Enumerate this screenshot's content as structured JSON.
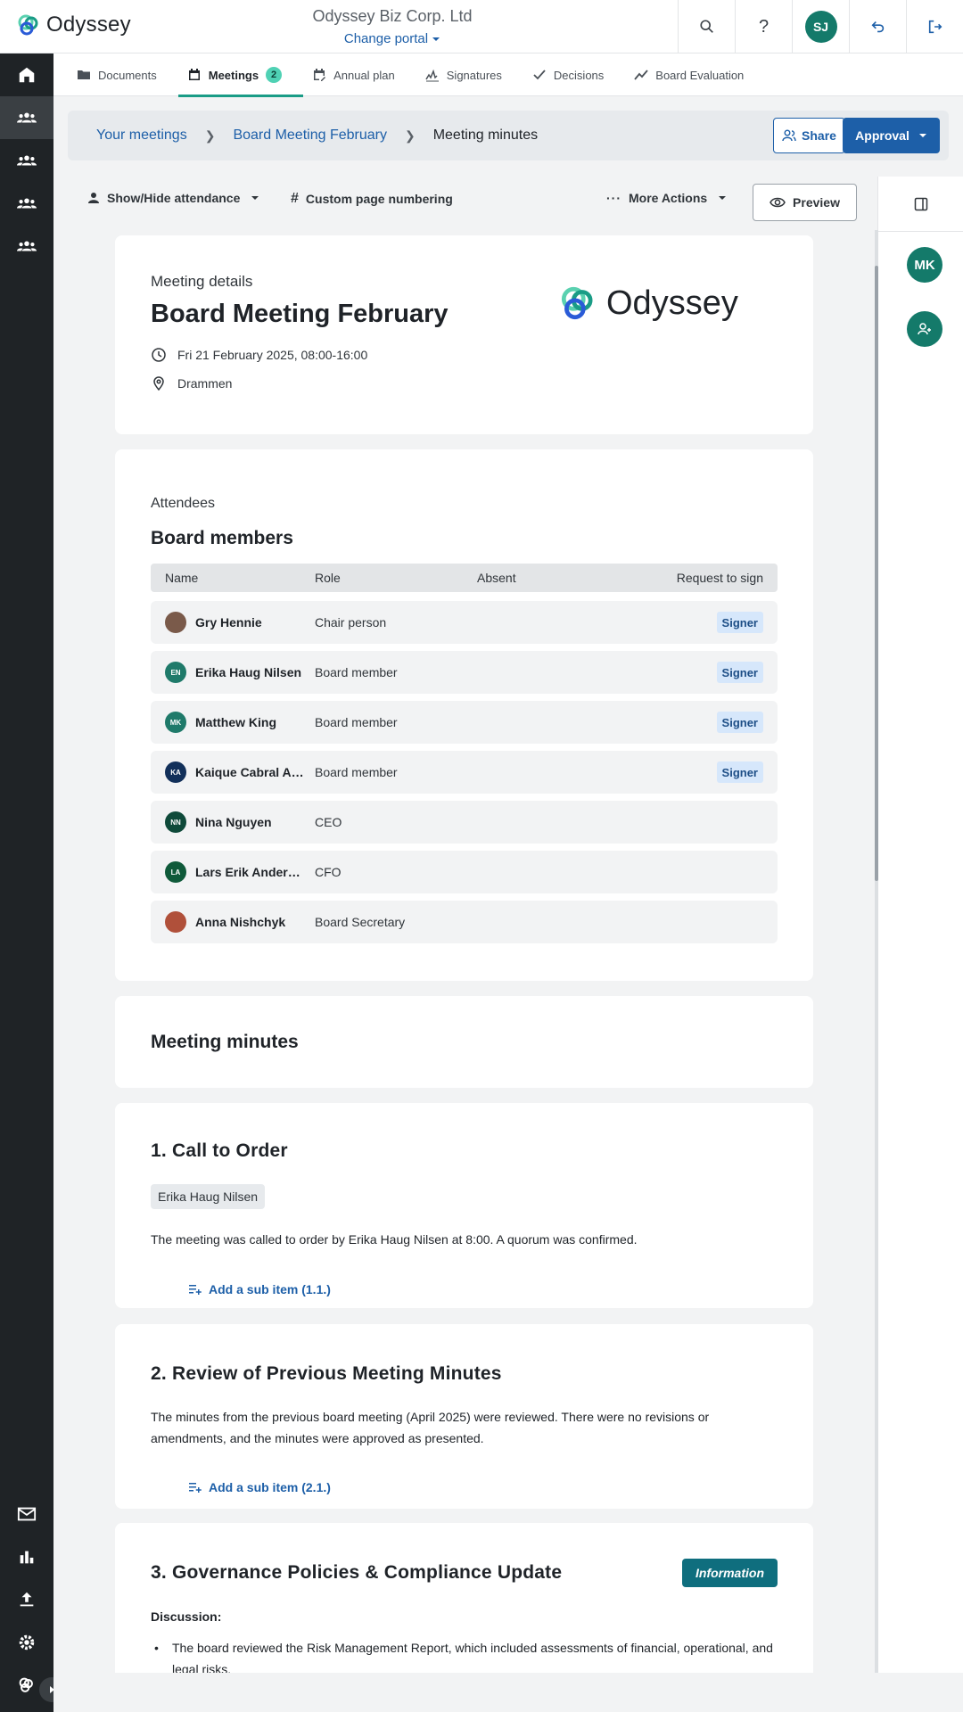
{
  "brand": {
    "name": "Odyssey",
    "accent": "#1a9c86",
    "link": "#1d5fa8"
  },
  "topbar": {
    "org_name": "Odyssey Biz Corp. Ltd",
    "change_portal": "Change portal",
    "user_initials": "SJ"
  },
  "tabs": [
    {
      "label": "Documents"
    },
    {
      "label": "Meetings",
      "badge": "2"
    },
    {
      "label": "Annual plan"
    },
    {
      "label": "Signatures"
    },
    {
      "label": "Decisions"
    },
    {
      "label": "Board Evaluation"
    }
  ],
  "breadcrumb": {
    "items": [
      "Your meetings",
      "Board Meeting February",
      "Meeting minutes"
    ]
  },
  "actions": {
    "share": "Share",
    "approval": "Approval"
  },
  "toolbar": {
    "attendance": "Show/Hide attendance",
    "numbering": "Custom page numbering",
    "more": "More Actions",
    "preview": "Preview"
  },
  "right_panel": {
    "avatar_initials": "MK"
  },
  "meeting": {
    "label": "Meeting details",
    "title": "Board Meeting February",
    "datetime": "Fri 21 February 2025, 08:00-16:00",
    "location": "Drammen"
  },
  "attendees": {
    "label": "Attendees",
    "group": "Board members",
    "headers": {
      "name": "Name",
      "role": "Role",
      "absent": "Absent",
      "sign": "Request to sign"
    },
    "rows": [
      {
        "initials": "",
        "name": "Gry Hennie",
        "role": "Chair person",
        "sign": "Signer",
        "avatar_color": "#7a5a4a"
      },
      {
        "initials": "EN",
        "name": "Erika Haug Nilsen",
        "role": "Board member",
        "sign": "Signer",
        "avatar_color": "#1f7a6a"
      },
      {
        "initials": "MK",
        "name": "Matthew King",
        "role": "Board member",
        "sign": "Signer",
        "avatar_color": "#1f7a6a"
      },
      {
        "initials": "KA",
        "name": "Kaique Cabral Alencar",
        "role": "Board member",
        "sign": "Signer",
        "avatar_color": "#12305a"
      },
      {
        "initials": "NN",
        "name": "Nina Nguyen",
        "role": "CEO",
        "sign": "",
        "avatar_color": "#0f4a3a"
      },
      {
        "initials": "LA",
        "name": "Lars Erik Andersen",
        "role": "CFO",
        "sign": "",
        "avatar_color": "#0f5a3a"
      },
      {
        "initials": "",
        "name": "Anna Nishchyk",
        "role": "Board Secretary",
        "sign": "",
        "avatar_color": "#b0503a"
      }
    ]
  },
  "minutes": {
    "heading": "Meeting minutes",
    "items": [
      {
        "title": "1. Call to Order",
        "chip": "Erika Haug Nilsen",
        "text": "The meeting was called to order by Erika Haug Nilsen at 8:00. A quorum was confirmed.",
        "subitem": "Add a sub item (1.1.)"
      },
      {
        "title": "2. Review of Previous Meeting Minutes",
        "text": "The minutes from the previous board meeting (April 2025) were reviewed. There were no revisions or amendments, and the minutes were approved as presented.",
        "subitem": "Add a sub item (2.1.)"
      },
      {
        "title": "3. Governance Policies & Compliance Update",
        "badge": "Information",
        "discussion_label": "Discussion:",
        "bullet": "The board reviewed the Risk Management Report, which included assessments of financial, operational, and legal risks."
      }
    ]
  }
}
